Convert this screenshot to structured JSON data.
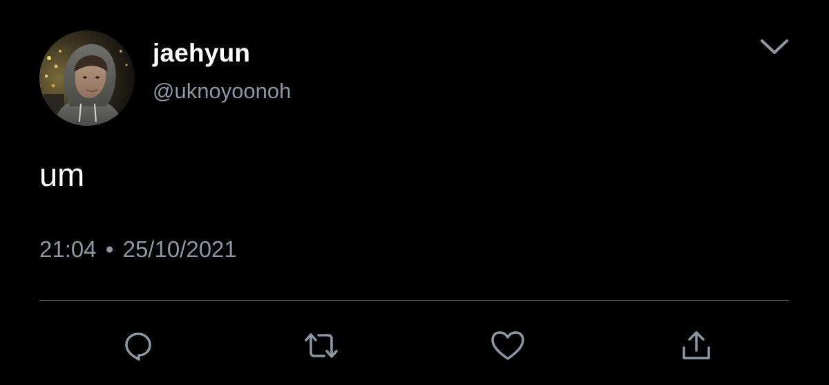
{
  "tweet": {
    "author": {
      "display_name": "jaehyun",
      "handle": "@uknoyoonoh",
      "avatar": "avatar-photo"
    },
    "text": "um",
    "time": "21:04",
    "separator": "•",
    "date": "25/10/2021",
    "menu_icon": "chevron-down-icon"
  },
  "actions": [
    {
      "name": "reply",
      "icon": "reply-icon"
    },
    {
      "name": "retweet",
      "icon": "retweet-icon"
    },
    {
      "name": "like",
      "icon": "heart-icon"
    },
    {
      "name": "share",
      "icon": "share-icon"
    }
  ],
  "colors": {
    "background": "#000000",
    "primary_text": "#ffffff",
    "secondary_text": "#8b98a5",
    "icon": "#8b98a5",
    "divider": "#5b6670"
  }
}
